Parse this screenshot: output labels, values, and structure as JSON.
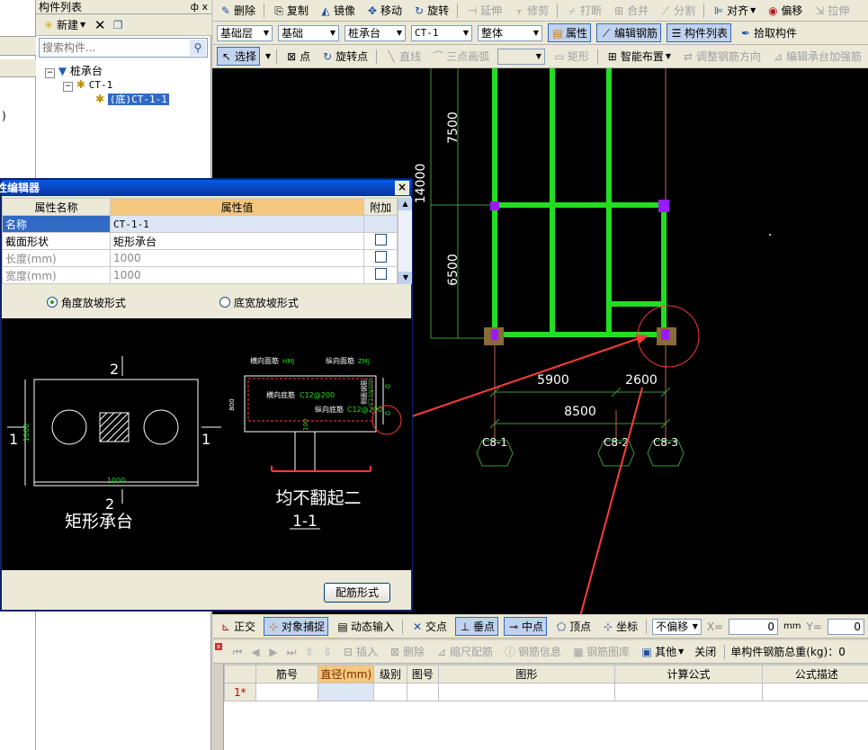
{
  "component_panel": {
    "title": "构件列表",
    "pin": "ф x",
    "new_label": "新建",
    "search_placeholder": "搜索构件...",
    "tree": {
      "root": "桩承台",
      "child": "CT-1",
      "leaf": "(底)CT-1-1"
    }
  },
  "left_edge_text": ")",
  "toolbar1": [
    "删除",
    "复制",
    "镜像",
    "移动",
    "旋转",
    "延伸",
    "修剪",
    "打断",
    "合并",
    "分割",
    "对齐",
    "偏移",
    "拉伸"
  ],
  "toolbar2": {
    "floor": "基础层",
    "type": "基础",
    "category": "桩承台",
    "component": "CT-1",
    "scope": "整体",
    "btn_property": "属性",
    "btn_edit_rebar": "编辑钢筋",
    "btn_component_list": "构件列表",
    "btn_pick": "拾取构件"
  },
  "toolbar3": {
    "select": "选择",
    "point": "点",
    "rotate_point": "旋转点",
    "line": "直线",
    "arc": "三点画弧",
    "rect": "矩形",
    "smart": "智能布置",
    "adjust": "调整钢筋方向",
    "edit_add": "编辑承台加强筋"
  },
  "editor": {
    "title": "属性编辑器",
    "close": "×",
    "headers": [
      "属性名称",
      "属性值",
      "附加"
    ],
    "rows": [
      {
        "name": "名称",
        "value": "CT-1-1"
      },
      {
        "name": "截面形状",
        "value": "矩形承台"
      },
      {
        "name": "长度(mm)",
        "value": "1000"
      },
      {
        "name": "宽度(mm)",
        "value": "1000"
      }
    ],
    "radio1": "角度放坡形式",
    "radio2": "底宽放坡形式",
    "plan_label": "矩形承台",
    "section_title": "均不翻起二",
    "section_no": "1-1",
    "mark_2": "2",
    "mark_1": "1",
    "dim_1000": "1000",
    "dim_800": "800",
    "tag_top_h": "横向面筋",
    "tag_top_h_val": "HMJ",
    "tag_top_v": "纵向面筋",
    "tag_top_v_val": "ZMJ",
    "tag_bot_h": "横向底筋",
    "tag_bot_h_val": "C12@200",
    "tag_bot_v": "纵向底筋",
    "tag_bot_v_val": "C12@200",
    "tag_side": "侧面钢筋",
    "tag_side_val": "C12@200",
    "dim_100": "100",
    "dim_0a": "0",
    "dim_0b": "0",
    "btn": "配筋形式"
  },
  "cad": {
    "dims": {
      "d7500": "7500",
      "d14000": "14000",
      "d6500": "6500",
      "d5900": "5900",
      "d2600": "2600",
      "d8500": "8500"
    },
    "axes": [
      "C8-1",
      "C8-2",
      "C8-3"
    ],
    "colors": {
      "beam": "#22dd22",
      "axis": "#c06060",
      "dim": "#3a9a3a",
      "node": "#9a1aff",
      "arrow": "#ff3b3b"
    }
  },
  "snap_bar": {
    "ortho": "正交",
    "snap": "对象捕捉",
    "dyn": "动态输入",
    "inter": "交点",
    "perp": "垂点",
    "mid": "中点",
    "vertex": "顶点",
    "coord": "坐标",
    "offset": "不偏移",
    "x_label": "X=",
    "x_val": "0",
    "y_label": "Y=",
    "y_val": "0",
    "mm": "mm"
  },
  "rebar_bar": {
    "insert": "插入",
    "delete": "删除",
    "scale": "缩尺配筋",
    "info": "钢筋信息",
    "lib": "钢筋图库",
    "other": "其他",
    "close": "关闭",
    "total": "单构件钢筋总重(kg)：0"
  },
  "rebar_table": {
    "headers": [
      "筋号",
      "直径(mm)",
      "级别",
      "图号",
      "图形",
      "计算公式",
      "公式描述"
    ],
    "row1": "1*"
  }
}
